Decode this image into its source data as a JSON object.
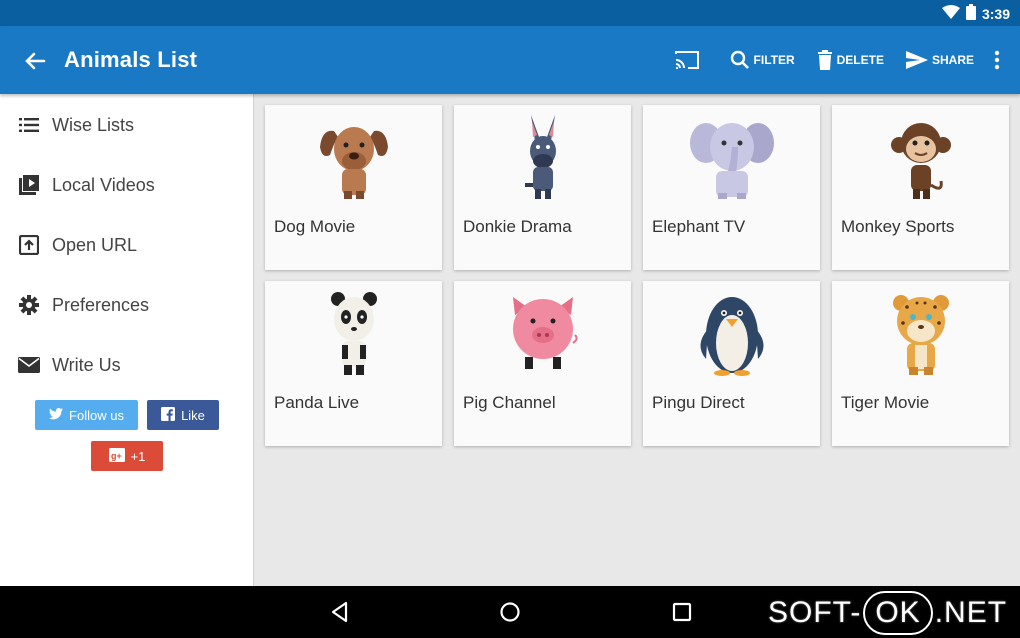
{
  "statusbar": {
    "time": "3:39"
  },
  "appbar": {
    "title": "Animals List",
    "actions": {
      "filter": "FILTER",
      "delete": "DELETE",
      "share": "SHARE"
    }
  },
  "sidebar": {
    "items": [
      {
        "label": "Wise Lists",
        "icon": "list-icon"
      },
      {
        "label": "Local Videos",
        "icon": "video-icon"
      },
      {
        "label": "Open URL",
        "icon": "open-url-icon"
      },
      {
        "label": "Preferences",
        "icon": "gear-icon"
      },
      {
        "label": "Write Us",
        "icon": "mail-icon"
      }
    ],
    "social": {
      "twitter": "Follow us",
      "facebook": "Like",
      "google": "+1"
    }
  },
  "cards": [
    {
      "label": "Dog Movie",
      "icon": "dog-icon"
    },
    {
      "label": "Donkie Drama",
      "icon": "donkey-icon"
    },
    {
      "label": "Elephant TV",
      "icon": "elephant-icon"
    },
    {
      "label": "Monkey Sports",
      "icon": "monkey-icon"
    },
    {
      "label": "Panda Live",
      "icon": "panda-icon"
    },
    {
      "label": "Pig Channel",
      "icon": "pig-icon"
    },
    {
      "label": "Pingu Direct",
      "icon": "penguin-icon"
    },
    {
      "label": "Tiger Movie",
      "icon": "tiger-icon"
    }
  ],
  "watermark": {
    "left": "SOFT-",
    "ok": "OK",
    "right": ".NET"
  },
  "colors": {
    "appbar": "#1a79c4",
    "statusbar": "#0a5fa0",
    "twitter": "#55acee",
    "facebook": "#3b5998",
    "google": "#dc4a38"
  }
}
